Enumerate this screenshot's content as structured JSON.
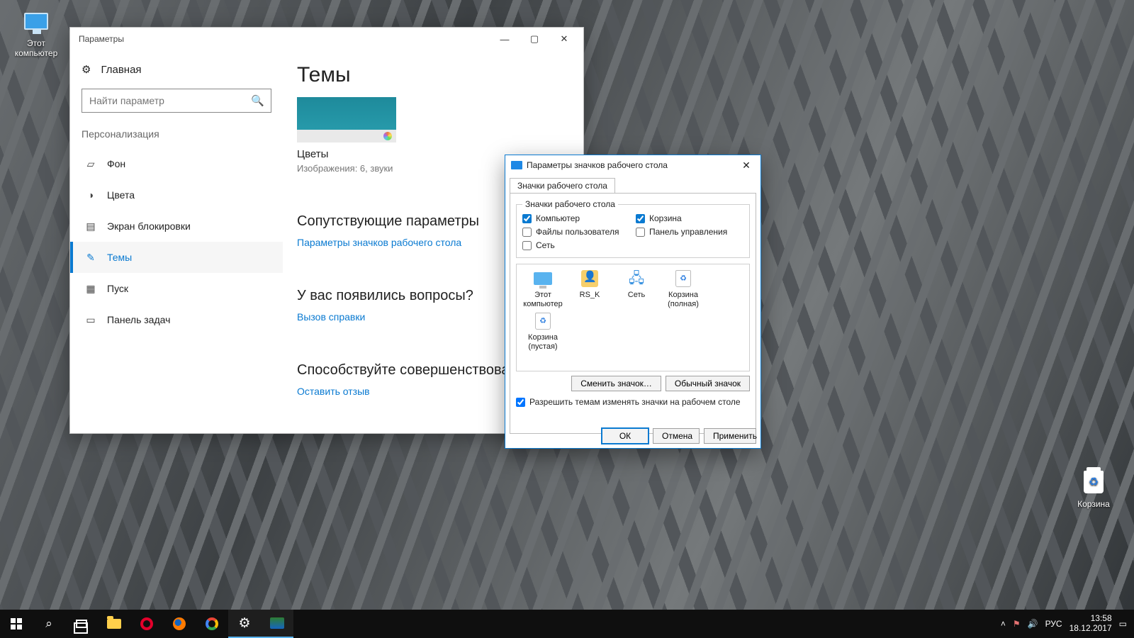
{
  "desktop": {
    "thisPC": "Этот\nкомпьютер",
    "recycleBin": "Корзина"
  },
  "settings": {
    "title": "Параметры",
    "home": "Главная",
    "searchPlaceholder": "Найти параметр",
    "section": "Персонализация",
    "nav": {
      "background": "Фон",
      "colors": "Цвета",
      "lockscreen": "Экран блокировки",
      "themes": "Темы",
      "start": "Пуск",
      "taskbar": "Панель задач"
    },
    "main": {
      "heading": "Темы",
      "themeName": "Цветы",
      "themeSub": "Изображения: 6, звуки",
      "h2a": "Сопутствующие параметры",
      "link1": "Параметры значков рабочего стола",
      "h2b": "У вас появились вопросы?",
      "link2": "Вызов справки",
      "h2c": "Способствуйте совершенствованию",
      "link3": "Оставить отзыв"
    }
  },
  "dialog": {
    "title": "Параметры значков рабочего стола",
    "tab": "Значки рабочего стола",
    "groupTitle": "Значки рабочего стола",
    "checks": {
      "computer": "Компьютер",
      "recycle": "Корзина",
      "userfiles": "Файлы пользователя",
      "cpanel": "Панель управления",
      "network": "Сеть"
    },
    "previews": {
      "thispc": "Этот\nкомпьютер",
      "user": "RS_K",
      "network": "Сеть",
      "binfull": "Корзина\n(полная)",
      "binempty": "Корзина\n(пустая)"
    },
    "changeIcon": "Сменить значок…",
    "defaultIcon": "Обычный значок",
    "allowThemes": "Разрешить темам изменять значки на рабочем столе",
    "ok": "ОК",
    "cancel": "Отмена",
    "apply": "Применить",
    "close": "✕"
  },
  "taskbar": {
    "lang": "РУС",
    "time": "13:58",
    "date": "18.12.2017"
  }
}
